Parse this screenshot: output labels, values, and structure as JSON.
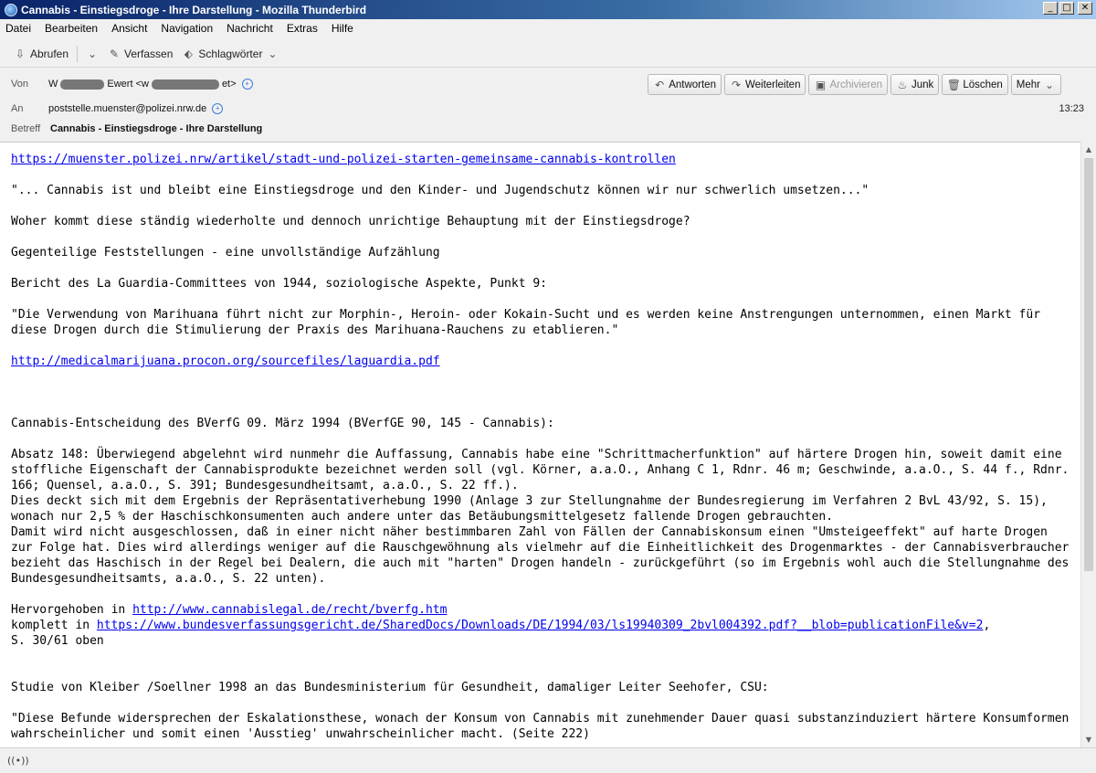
{
  "window": {
    "title": "Cannabis - Einstiegsdroge - Ihre Darstellung - Mozilla Thunderbird"
  },
  "menu": [
    "Datei",
    "Bearbeiten",
    "Ansicht",
    "Navigation",
    "Nachricht",
    "Extras",
    "Hilfe"
  ],
  "toolbar": {
    "get_messages": "Abrufen",
    "write": "Verfassen",
    "tags": "Schlagwörter"
  },
  "header": {
    "from_label": "Von",
    "from_name_start": "W",
    "from_name_mid": "Ewert <w",
    "from_name_end": "et>",
    "to_label": "An",
    "to_value": "poststelle.muenster@polizei.nrw.de",
    "subject_label": "Betreff",
    "subject_value": "Cannabis - Einstiegsdroge - Ihre Darstellung",
    "time": "13:23",
    "buttons": {
      "reply": "Antworten",
      "forward": "Weiterleiten",
      "archive": "Archivieren",
      "junk": "Junk",
      "delete": "Löschen",
      "more": "Mehr"
    }
  },
  "body": {
    "link1": "https://muenster.polizei.nrw/artikel/stadt-und-polizei-starten-gemeinsame-cannabis-kontrollen",
    "quote1": "\"... Cannabis ist und bleibt eine Einstiegsdroge und den Kinder- und Jugendschutz können wir nur schwerlich umsetzen...\"",
    "question": "Woher kommt diese ständig wiederholte und dennoch unrichtige Behauptung mit der Einstiegsdroge?",
    "heading": "Gegenteilige Feststellungen - eine unvollständige Aufzählung",
    "laguardia_intro": "Bericht des La Guardia-Committees von 1944, soziologische Aspekte, Punkt 9:",
    "laguardia_quote": "\"Die Verwendung von Marihuana führt nicht zur Morphin-, Heroin- oder Kokain-Sucht und es werden keine Anstrengungen unternommen, einen Markt für diese Drogen durch die Stimulierung der Praxis des Marihuana-Rauchens zu etablieren.\"",
    "link2": "http://medicalmarijuana.procon.org/sourcefiles/laguardia.pdf",
    "bverfg_intro": "Cannabis-Entscheidung des BVerfG 09. März 1994 (BVerfGE 90, 145 - Cannabis):",
    "bverfg_text": "Absatz 148: Überwiegend abgelehnt wird nunmehr die Auffassung, Cannabis habe eine \"Schrittmacherfunktion\" auf härtere Drogen hin, soweit damit eine stoffliche Eigenschaft der Cannabisprodukte bezeichnet werden soll (vgl. Körner, a.a.O., Anhang C 1, Rdnr. 46 m; Geschwinde, a.a.O., S. 44 f., Rdnr. 166; Quensel, a.a.O., S. 391; Bundesgesundheitsamt, a.a.O., S. 22 ff.).\nDies deckt sich mit dem Ergebnis der Repräsentativerhebung 1990 (Anlage 3 zur Stellungnahme der Bundesregierung im Verfahren 2 BvL 43/92, S. 15), wonach nur 2,5 % der Haschischkonsumenten auch andere unter das Betäubungsmittelgesetz fallende Drogen gebrauchten.\nDamit wird nicht ausgeschlossen, daß in einer nicht näher bestimmbaren Zahl von Fällen der Cannabiskonsum einen \"Umsteigeeffekt\" auf harte Drogen zur Folge hat. Dies wird allerdings weniger auf die Rauschgewöhnung als vielmehr auf die Einheitlichkeit des Drogenmarktes - der Cannabisverbraucher bezieht das Haschisch in der Regel bei Dealern, die auch mit \"harten\" Drogen handeln - zurückgeführt (so im Ergebnis wohl auch die Stellungnahme des Bundesgesundheitsamts, a.a.O., S. 22 unten).",
    "highlight_prefix": "Hervorgehoben in ",
    "link3": "http://www.cannabislegal.de/recht/bverfg.htm",
    "complete_prefix": "komplett in ",
    "link4": "https://www.bundesverfassungsgericht.de/SharedDocs/Downloads/DE/1994/03/ls19940309_2bvl004392.pdf?__blob=publicationFile&v=2",
    "link4_suffix": ",",
    "pages": "S. 30/61 oben",
    "kleiber_intro": "Studie von Kleiber /Soellner 1998 an das Bundesministerium für Gesundheit, damaliger Leiter Seehofer, CSU:",
    "kleiber_quote": "\"Diese Befunde widersprechen der Eskalationsthese, wonach der Konsum von Cannabis mit zunehmender Dauer quasi substanzinduziert härtere Konsumformen wahrscheinlicher und somit einen 'Ausstieg' unwahrscheinlicher macht. (Seite 222)"
  },
  "icons": {
    "app": "thunderbird-icon",
    "get": "download-icon",
    "write": "pencil-icon",
    "tags": "tag-icon",
    "reply": "reply-icon",
    "forward": "forward-icon",
    "archive": "archive-icon",
    "junk": "flame-icon",
    "delete": "trash-icon",
    "status": "wireless-icon"
  }
}
